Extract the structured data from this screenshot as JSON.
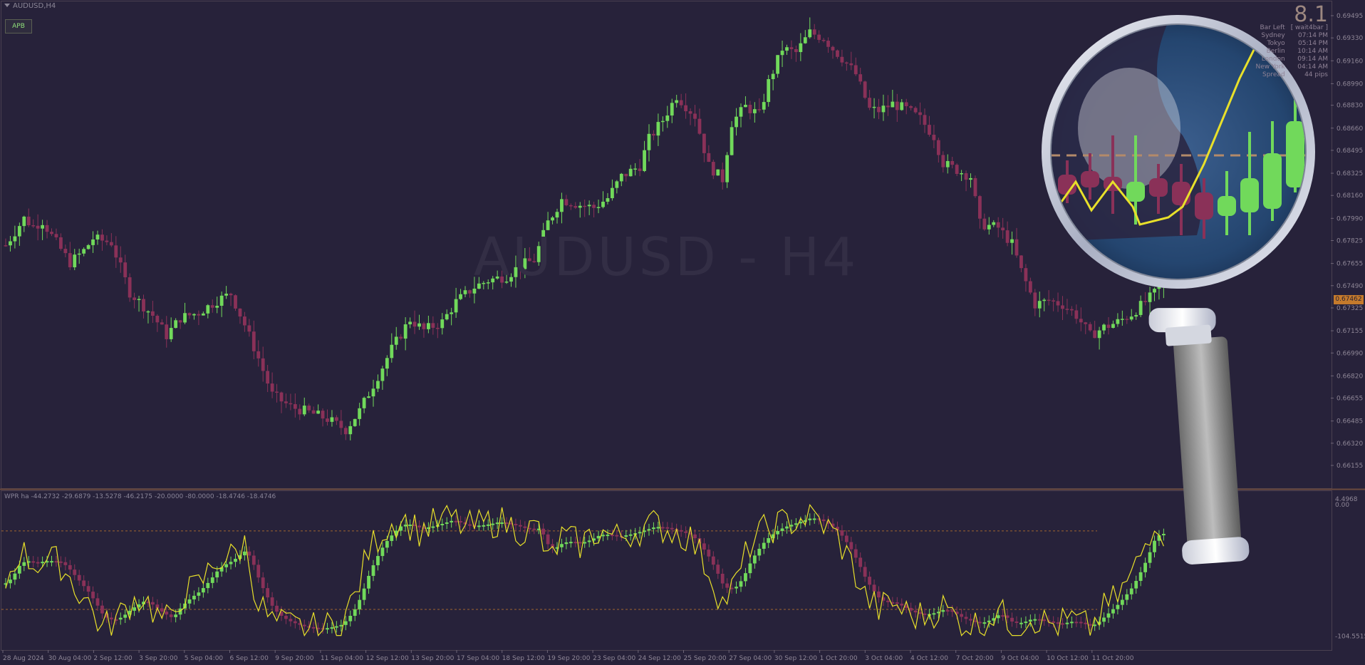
{
  "window": {
    "symbol_title": "AUDUSD,H4",
    "watermark": "AUDUSD - H4"
  },
  "apb_button": {
    "label": "APB"
  },
  "info_panel": {
    "countdown": "8.1",
    "rows": [
      {
        "label": "Bar Left",
        "value": "[ wait4bar ]"
      },
      {
        "label": "Sydney",
        "value": "07:14 PM"
      },
      {
        "label": "Tokyo",
        "value": "05:14 PM"
      },
      {
        "label": "Berlin",
        "value": "10:14 AM"
      },
      {
        "label": "London",
        "value": "09:14 AM"
      },
      {
        "label": "New York",
        "value": "04:14 AM"
      },
      {
        "label": "Spread",
        "value": "44 pips"
      }
    ]
  },
  "price_axis": {
    "labels": [
      "0.69495",
      "0.69330",
      "0.69160",
      "0.68990",
      "0.68830",
      "0.68660",
      "0.68495",
      "0.68325",
      "0.68160",
      "0.67990",
      "0.67825",
      "0.67655",
      "0.67490",
      "0.67325",
      "0.67155",
      "0.66990",
      "0.66820",
      "0.66655",
      "0.66485",
      "0.66320",
      "0.66155"
    ],
    "current_price": "0.67462"
  },
  "indicator": {
    "label": "WPR ha -44.2732 -29.6879 -13.5278 -46.2175 -20.0000 -80.0000 -18.4746 -18.4746",
    "axis_top": "4.4968",
    "axis_top2": "0.00",
    "axis_bottom": "-104.5515"
  },
  "time_axis": [
    "28 Aug 2024",
    "30 Aug 04:00",
    "2 Sep 12:00",
    "3 Sep 20:00",
    "5 Sep 04:00",
    "6 Sep 12:00",
    "9 Sep 20:00",
    "11 Sep 04:00",
    "12 Sep 12:00",
    "13 Sep 20:00",
    "17 Sep 04:00",
    "18 Sep 12:00",
    "19 Sep 20:00",
    "23 Sep 04:00",
    "24 Sep 12:00",
    "25 Sep 20:00",
    "27 Sep 04:00",
    "30 Sep 12:00",
    "1 Oct 20:00",
    "3 Oct 04:00",
    "4 Oct 12:00",
    "7 Oct 20:00",
    "9 Oct 04:00",
    "10 Oct 12:00",
    "11 Oct 20:00"
  ],
  "chart_data": {
    "type": "candlestick",
    "title": "AUDUSD - H4",
    "ylim": [
      0.6607,
      0.6955
    ],
    "bull_color": "#71d95b",
    "bear_color": "#8a3158",
    "wpr_color": "#e8e02a",
    "wpr_levels": [
      -20,
      -80
    ],
    "wpr_ylim": [
      -104.5515,
      4.4968
    ],
    "close_path": [
      [
        0,
        0.6779
      ],
      [
        4,
        0.6799
      ],
      [
        6,
        0.6793
      ],
      [
        8,
        0.6797
      ],
      [
        10,
        0.6786
      ],
      [
        14,
        0.6766
      ],
      [
        17,
        0.6775
      ],
      [
        19,
        0.6784
      ],
      [
        23,
        0.6781
      ],
      [
        27,
        0.6744
      ],
      [
        32,
        0.6727
      ],
      [
        35,
        0.6712
      ],
      [
        38,
        0.6725
      ],
      [
        42,
        0.6729
      ],
      [
        46,
        0.6738
      ],
      [
        49,
        0.6743
      ],
      [
        52,
        0.672
      ],
      [
        55,
        0.6695
      ],
      [
        58,
        0.6668
      ],
      [
        62,
        0.6659
      ],
      [
        66,
        0.6655
      ],
      [
        70,
        0.665
      ],
      [
        74,
        0.6642
      ],
      [
        77,
        0.6656
      ],
      [
        81,
        0.6682
      ],
      [
        84,
        0.6702
      ],
      [
        88,
        0.6724
      ],
      [
        91,
        0.6716
      ],
      [
        95,
        0.6722
      ],
      [
        98,
        0.6737
      ],
      [
        102,
        0.6748
      ],
      [
        105,
        0.6753
      ],
      [
        109,
        0.6756
      ],
      [
        112,
        0.6764
      ],
      [
        115,
        0.6768
      ],
      [
        118,
        0.6796
      ],
      [
        121,
        0.6813
      ],
      [
        125,
        0.6809
      ],
      [
        128,
        0.6807
      ],
      [
        131,
        0.6814
      ],
      [
        134,
        0.683
      ],
      [
        138,
        0.6838
      ],
      [
        140,
        0.6858
      ],
      [
        143,
        0.6872
      ],
      [
        146,
        0.689
      ],
      [
        150,
        0.6875
      ],
      [
        153,
        0.6838
      ],
      [
        156,
        0.6828
      ],
      [
        158,
        0.687
      ],
      [
        161,
        0.6882
      ],
      [
        164,
        0.6876
      ],
      [
        166,
        0.69
      ],
      [
        169,
        0.6925
      ],
      [
        172,
        0.6922
      ],
      [
        175,
        0.6937
      ],
      [
        178,
        0.6933
      ],
      [
        180,
        0.6925
      ],
      [
        182,
        0.6918
      ],
      [
        185,
        0.6906
      ],
      [
        188,
        0.688
      ],
      [
        190,
        0.6879
      ],
      [
        193,
        0.6884
      ],
      [
        196,
        0.688
      ],
      [
        199,
        0.6873
      ],
      [
        202,
        0.686
      ],
      [
        204,
        0.684
      ],
      [
        207,
        0.6835
      ],
      [
        210,
        0.683
      ],
      [
        212,
        0.6795
      ],
      [
        216,
        0.6792
      ],
      [
        219,
        0.678
      ],
      [
        221,
        0.676
      ],
      [
        224,
        0.6735
      ],
      [
        227,
        0.6738
      ],
      [
        230,
        0.6735
      ],
      [
        233,
        0.6727
      ],
      [
        236,
        0.6712
      ],
      [
        239,
        0.6718
      ],
      [
        242,
        0.6722
      ],
      [
        245,
        0.6728
      ],
      [
        249,
        0.674
      ],
      [
        252,
        0.675
      ]
    ],
    "wpr_path": [
      [
        0,
        -60
      ],
      [
        3,
        -35
      ],
      [
        6,
        -45
      ],
      [
        9,
        -42
      ],
      [
        12,
        -45
      ],
      [
        15,
        -62
      ],
      [
        18,
        -75
      ],
      [
        21,
        -95
      ],
      [
        24,
        -88
      ],
      [
        27,
        -75
      ],
      [
        30,
        -70
      ],
      [
        33,
        -85
      ],
      [
        36,
        -90
      ],
      [
        38,
        -70
      ],
      [
        42,
        -62
      ],
      [
        46,
        -42
      ],
      [
        49,
        -40
      ],
      [
        52,
        -30
      ],
      [
        55,
        -75
      ],
      [
        58,
        -90
      ],
      [
        61,
        -92
      ],
      [
        65,
        -95
      ],
      [
        69,
        -95
      ],
      [
        73,
        -90
      ],
      [
        76,
        -70
      ],
      [
        79,
        -35
      ],
      [
        82,
        -20
      ],
      [
        86,
        -10
      ],
      [
        90,
        -20
      ],
      [
        93,
        -15
      ],
      [
        97,
        -10
      ],
      [
        100,
        -18
      ],
      [
        104,
        -15
      ],
      [
        107,
        -12
      ],
      [
        110,
        -16
      ],
      [
        113,
        -20
      ],
      [
        116,
        -18
      ],
      [
        118,
        -45
      ],
      [
        121,
        -25
      ],
      [
        125,
        -30
      ],
      [
        129,
        -20
      ],
      [
        133,
        -25
      ],
      [
        137,
        -20
      ],
      [
        141,
        -15
      ],
      [
        145,
        -20
      ],
      [
        149,
        -25
      ],
      [
        153,
        -50
      ],
      [
        156,
        -75
      ],
      [
        159,
        -60
      ],
      [
        162,
        -30
      ],
      [
        165,
        -20
      ],
      [
        168,
        -15
      ],
      [
        172,
        -12
      ],
      [
        175,
        -8
      ],
      [
        178,
        -15
      ],
      [
        181,
        -25
      ],
      [
        184,
        -45
      ],
      [
        187,
        -70
      ],
      [
        190,
        -80
      ],
      [
        193,
        -75
      ],
      [
        197,
        -85
      ],
      [
        200,
        -85
      ],
      [
        204,
        -78
      ],
      [
        208,
        -90
      ],
      [
        212,
        -92
      ],
      [
        216,
        -80
      ],
      [
        219,
        -95
      ],
      [
        223,
        -85
      ],
      [
        226,
        -90
      ],
      [
        229,
        -92
      ],
      [
        232,
        -88
      ],
      [
        236,
        -95
      ],
      [
        239,
        -80
      ],
      [
        242,
        -70
      ],
      [
        245,
        -55
      ],
      [
        248,
        -30
      ],
      [
        250,
        -10
      ],
      [
        252,
        -20
      ]
    ]
  },
  "magnifier": {
    "icon": "magnifier-icon"
  }
}
